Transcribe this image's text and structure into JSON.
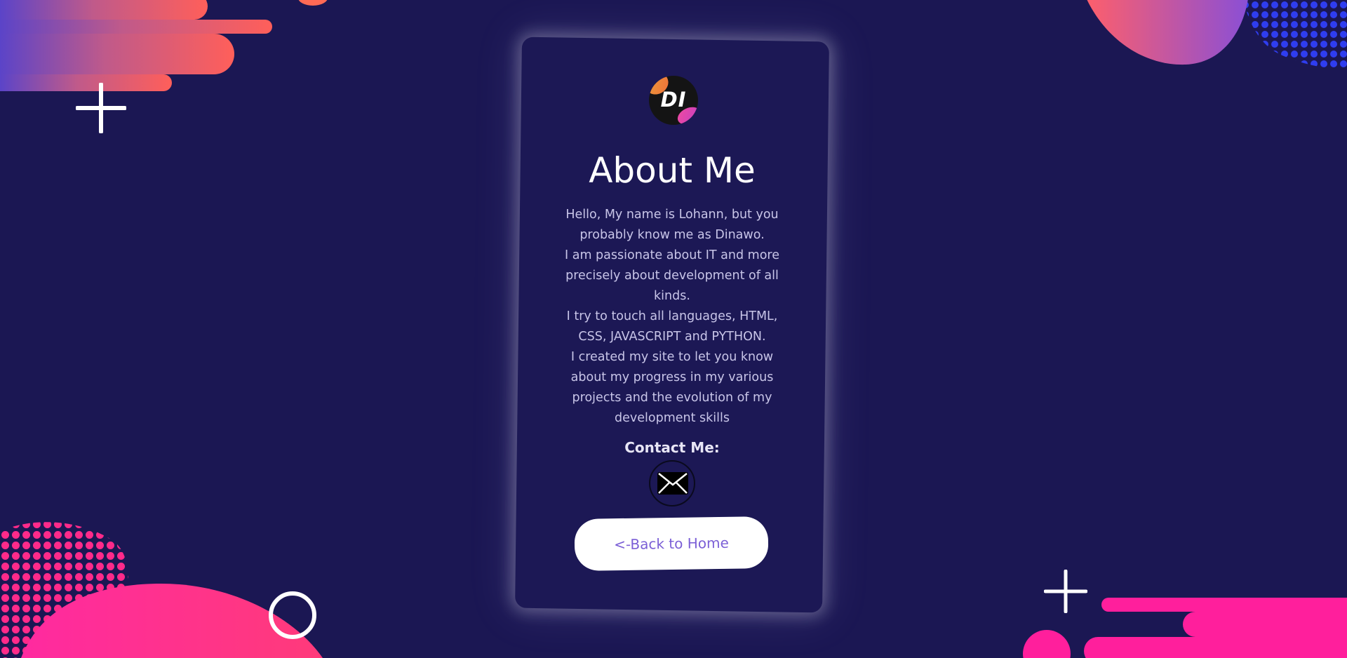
{
  "card": {
    "logo_text": "DI",
    "title": "About Me",
    "bio": [
      "Hello, My name is Lohann, but you probably know me as Dinawo.",
      "I am passionate about IT and more precisely about development of all kinds.",
      "I try to touch all languages, HTML, CSS, JAVASCRIPT and PYTHON.",
      "I created my site to let you know about my progress in my various projects and the evolution of my development skills"
    ],
    "contact_label": "Contact Me:",
    "home_button_label": "<-Back to Home"
  },
  "colors": {
    "background": "#1b1753",
    "card": "#1c1855",
    "accent_pink": "#ff1f9c",
    "accent_coral": "#ff5f5a",
    "accent_blue": "#2f3df0",
    "button_text": "#7b5fd6"
  },
  "icons": {
    "contact": "envelope-icon",
    "decor": [
      "plus-icon",
      "circle-outline-icon"
    ]
  }
}
